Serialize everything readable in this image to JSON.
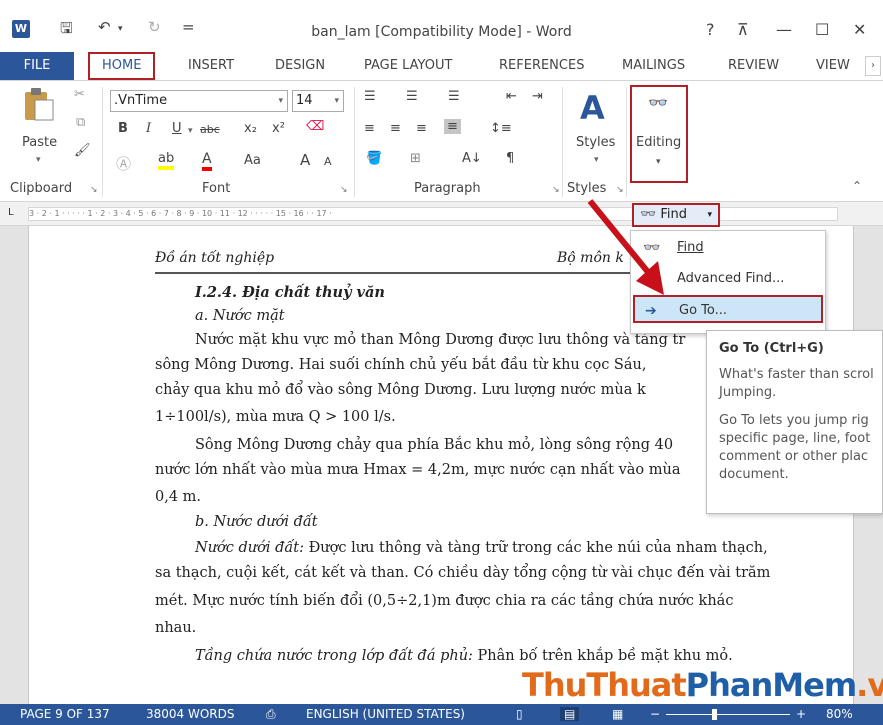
{
  "window": {
    "title": "ban_lam [Compatibility Mode] - Word",
    "help": "?",
    "ribbon_display": "⊼",
    "minimize": "—",
    "maximize": "☐",
    "close": "✕"
  },
  "quick_access": {
    "save_icon": "save-icon",
    "undo_icon": "undo-icon",
    "redo_icon": "redo-icon",
    "customize": "="
  },
  "tabs": {
    "file": "FILE",
    "home": "HOME",
    "insert": "INSERT",
    "design": "DESIGN",
    "page_layout": "PAGE LAYOUT",
    "references": "REFERENCES",
    "mailings": "MAILINGS",
    "review": "REVIEW",
    "view": "VIEW"
  },
  "ribbon": {
    "clipboard": {
      "label": "Clipboard",
      "paste": "Paste"
    },
    "font": {
      "label": "Font",
      "name": ".VnTime",
      "size": "14",
      "bold": "B",
      "italic": "I",
      "underline": "U",
      "strike": "abc",
      "sub": "x₂",
      "sup": "x²",
      "case": "Aa",
      "grow": "A",
      "shrink": "A"
    },
    "paragraph": {
      "label": "Paragraph",
      "pilcrow": "¶"
    },
    "styles": {
      "label": "Styles",
      "button": "Styles"
    },
    "editing": {
      "button": "Editing"
    }
  },
  "ruler": {
    "marks": "3 · 2 · 1 · · · · · 1 · 2 · 3 · 4 · 5 · 6 · 7 · 8 · 9 · 10 · 11 · 12 · · · · · 15 · 16 · · 17 ·"
  },
  "find_button": {
    "label": "Find"
  },
  "find_menu": {
    "find": "Find",
    "advanced": "Advanced Find...",
    "goto": "Go To..."
  },
  "tooltip": {
    "title": "Go To (Ctrl+G)",
    "line1": "What's faster than scrol",
    "line2": "Jumping.",
    "line3": "Go To lets you jump rig",
    "line4": "specific page, line, foot",
    "line5": "comment or other plac",
    "line6": "document."
  },
  "document": {
    "header_left": "Đồ án tốt nghiệp",
    "header_right": "Bộ môn k",
    "heading": "I.2.4. Địa chất thuỷ văn",
    "sub_a": "a. Nước mặt",
    "p1_l1": "Nước mặt khu vực mỏ than Mông Dương được lưu thông và tàng tr",
    "p1_l2": "sông Mông Dương. Hai suối chính chủ yếu bắt đầu từ khu cọc Sáu,",
    "p1_l3": "chảy qua khu mỏ đổ vào sông Mông Dương. Lưu lượng  nước mùa k",
    "p1_l4": "1÷100l/s), mùa mưa Q > 100 l/s.",
    "p2_l1": "Sông Mông Dương chảy qua phía Bắc khu mỏ, lòng sông rộng 40",
    "p2_l2": "nước lớn nhất vào mùa mưa Hmax = 4,2m, mực nước cạn nhất vào mùa",
    "p2_l3": "0,4 m.",
    "sub_b": "b. Nước dưới đất",
    "p3_l1_lead": "Nước dưới đất:",
    "p3_l1": " Được lưu thông và tàng trữ trong các khe núi của nham thạch,",
    "p3_l2": "sa thạch, cuội kết, cát kết và than. Có chiều dày tổng cộng từ vài chục đến vài trăm",
    "p3_l3": "mét. Mực nước tính biến đổi (0,5÷2,1)m được chia ra các tầng chứa nước khác",
    "p3_l4": "nhau.",
    "p4_l1_lead": "Tầng chứa nước trong lớp đất đá phủ:",
    "p4_l1": " Phân bố  trên khắp bề mặt khu mỏ."
  },
  "status": {
    "page": "PAGE 9 OF 137",
    "words": "38004 WORDS",
    "language": "ENGLISH (UNITED STATES)",
    "zoom": "80%",
    "zoom_minus": "−",
    "zoom_plus": "+"
  },
  "watermark": {
    "part1": "ThuThuat",
    "part2": "PhanMem",
    "part3": ".vn"
  },
  "colors": {
    "word_blue": "#2b579a",
    "highlight_red": "#b21f24",
    "menu_hover": "#cde6f7"
  }
}
